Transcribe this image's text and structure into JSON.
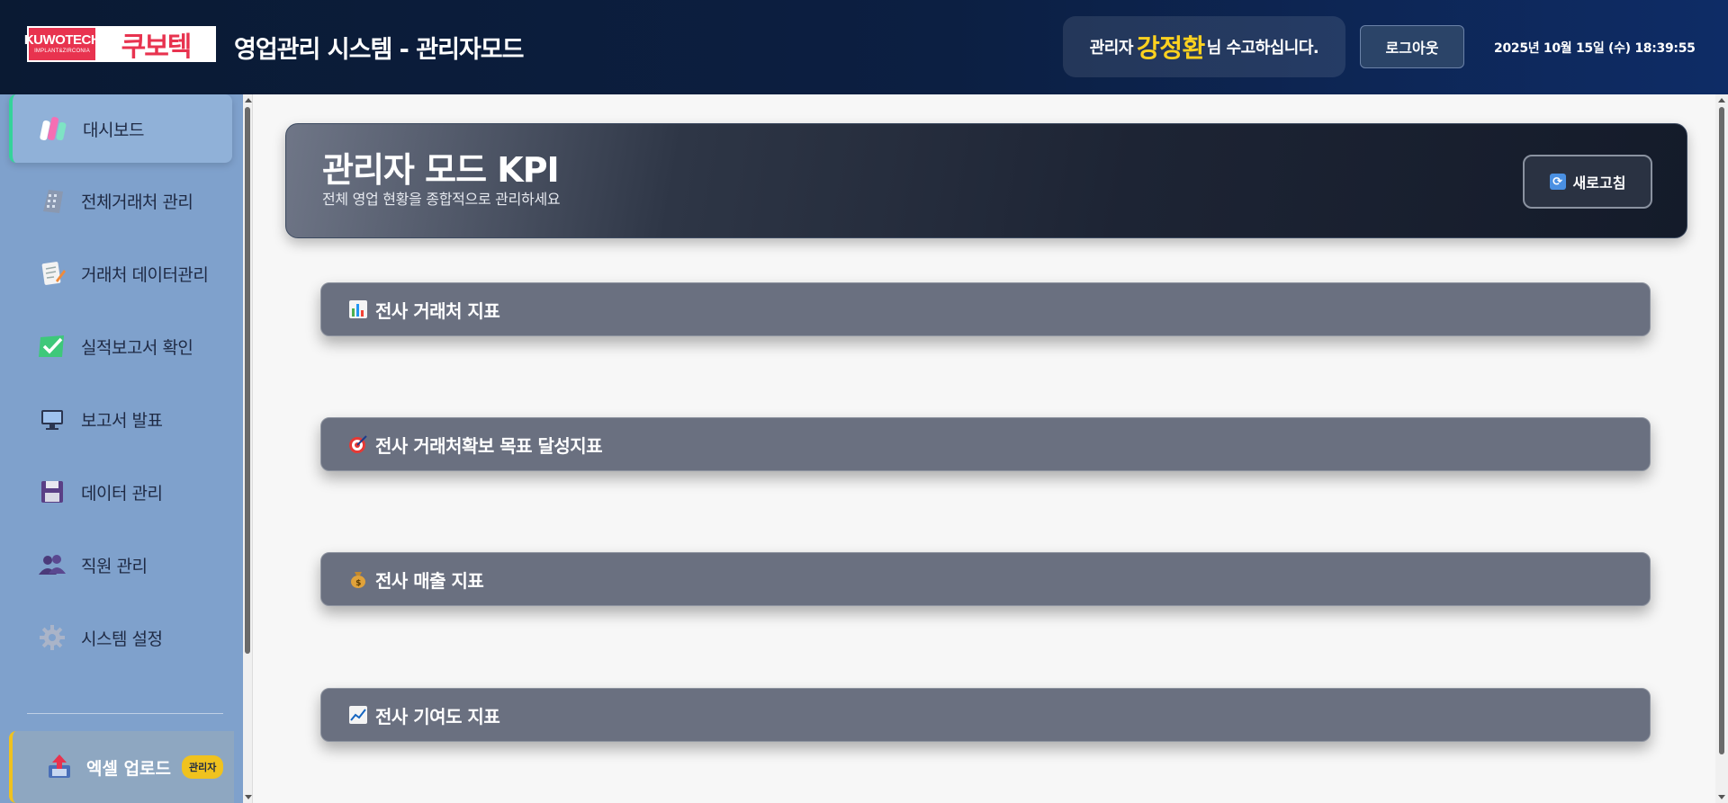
{
  "header": {
    "logo": {
      "brand": "KUWOTECH",
      "sub": "IMPLANT&ZIRCONIA",
      "korean": "쿠보텍"
    },
    "title": "영업관리 시스템 - 관리자모드",
    "welcome": {
      "prefix": "관리자",
      "name": "강정환",
      "suffix": "님 수고하십니다."
    },
    "logout_label": "로그아웃",
    "datetime": "2025년 10월 15일 (수) 18:39:55"
  },
  "sidebar": {
    "items": [
      {
        "label": "대시보드",
        "icon": "dashboard-icon",
        "active": true
      },
      {
        "label": "전체거래처 관리",
        "icon": "building-icon"
      },
      {
        "label": "거래처 데이터관리",
        "icon": "memo-icon"
      },
      {
        "label": "실적보고서 확인",
        "icon": "check-icon"
      },
      {
        "label": "보고서 발표",
        "icon": "monitor-icon"
      },
      {
        "label": "데이터 관리",
        "icon": "floppy-icon"
      },
      {
        "label": "직원 관리",
        "icon": "people-icon"
      },
      {
        "label": "시스템 설정",
        "icon": "gear-icon"
      }
    ],
    "upload": {
      "label": "엑셀 업로드",
      "badge": "관리자",
      "icon": "upload-icon"
    }
  },
  "kpi": {
    "title": "관리자 모드 KPI",
    "subtitle": "전체 영업 현황을 종합적으로 관리하세요",
    "refresh_label": "새로고침"
  },
  "sections": [
    {
      "title": "전사 거래처 지표",
      "icon": "bar-chart-icon"
    },
    {
      "title": "전사 거래처확보 목표 달성지표",
      "icon": "target-icon"
    },
    {
      "title": "전사 매출 지표",
      "icon": "money-bag-icon"
    },
    {
      "title": "전사 기여도 지표",
      "icon": "trend-chart-icon"
    }
  ],
  "colors": {
    "header_bg": "#0c1f42",
    "sidebar_bg": "#7fa1cc",
    "accent_green": "#35d39a",
    "accent_yellow": "#f0c21e",
    "welcome_name": "#ffd21f",
    "section_bg": "#6a7080"
  }
}
